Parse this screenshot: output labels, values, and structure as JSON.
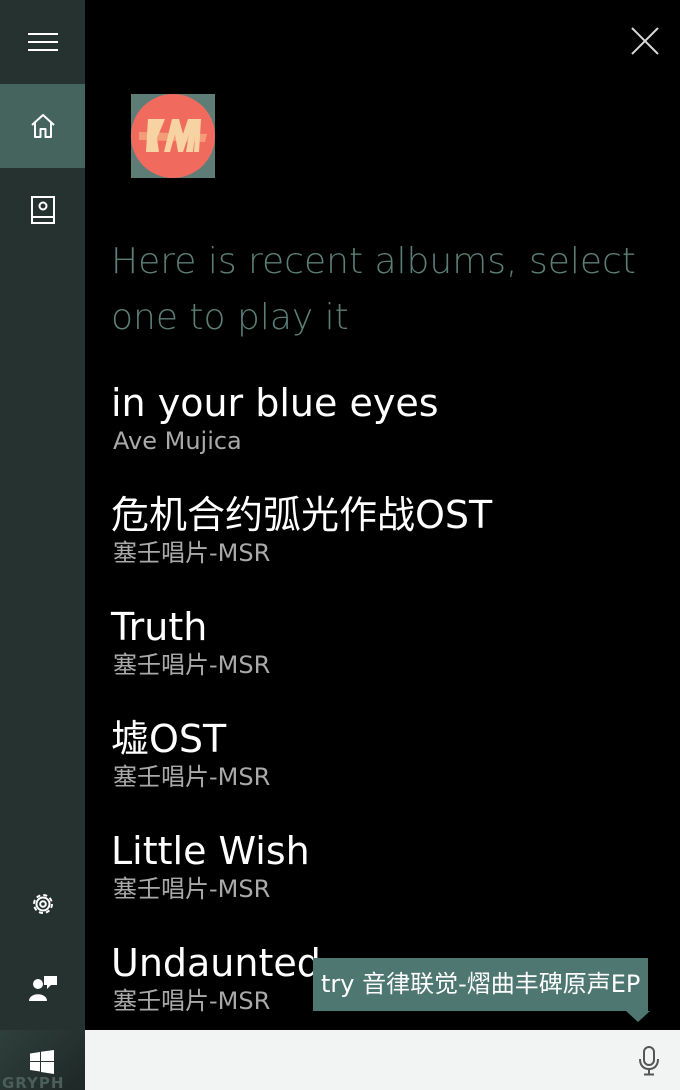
{
  "window": {
    "close_icon": "close-icon"
  },
  "sidebar": {
    "items": [
      {
        "name": "menu",
        "icon": "hamburger-menu-icon"
      },
      {
        "name": "home",
        "icon": "home-icon",
        "active": true
      },
      {
        "name": "notebook",
        "icon": "notebook-icon"
      },
      {
        "name": "settings",
        "icon": "gear-icon"
      },
      {
        "name": "feedback",
        "icon": "feedback-icon"
      }
    ],
    "start_icon": "windows-logo-icon",
    "wallpaper_text": "GRYPH"
  },
  "assistant": {
    "prompt": "Here is recent albums, select one to play it"
  },
  "albums": [
    {
      "title": "in your blue eyes",
      "artist": "Ave Mujica"
    },
    {
      "title": "危机合约弧光作战OST",
      "artist": "塞壬唱片-MSR"
    },
    {
      "title": "Truth",
      "artist": "塞壬唱片-MSR"
    },
    {
      "title": "墟OST",
      "artist": "塞壬唱片-MSR"
    },
    {
      "title": "Little Wish",
      "artist": "塞壬唱片-MSR"
    },
    {
      "title": "Undaunted",
      "artist": "塞壬唱片-MSR"
    }
  ],
  "suggestion": {
    "text": "try 音律联觉-熠曲丰碑原声EP"
  },
  "search": {
    "value": "",
    "placeholder": "",
    "mic_icon": "microphone-icon"
  },
  "colors": {
    "sidebar": "#26322f",
    "sidebar_active": "#45645e",
    "accent": "#4d7770",
    "prompt_text": "#5b7e77",
    "background": "#000000",
    "search_bar": "#f2f3f3"
  }
}
